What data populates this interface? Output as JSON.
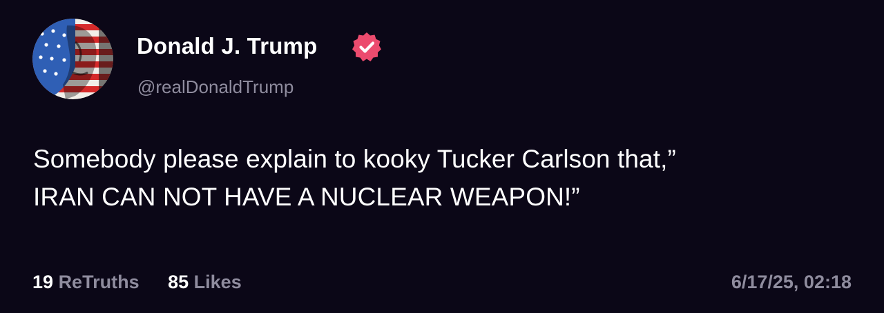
{
  "author": {
    "name": "Donald J. Trump",
    "handle": "@realDonaldTrump",
    "avatar_icon": "profile-photo-flag-avatar",
    "verified_icon": "verified-badge-icon",
    "verified_color": "#ec4b6e"
  },
  "post": {
    "lines": [
      "Somebody please explain to kooky Tucker Carlson that,”",
      "IRAN CAN NOT HAVE A NUCLEAR WEAPON!”"
    ]
  },
  "stats": {
    "retruths_count": "19",
    "retruths_label": "ReTruths",
    "likes_count": "85",
    "likes_label": "Likes"
  },
  "timestamp": "6/17/25, 02:18",
  "colors": {
    "background": "#0b0717",
    "text": "#ffffff",
    "muted": "#8f8c9e"
  }
}
